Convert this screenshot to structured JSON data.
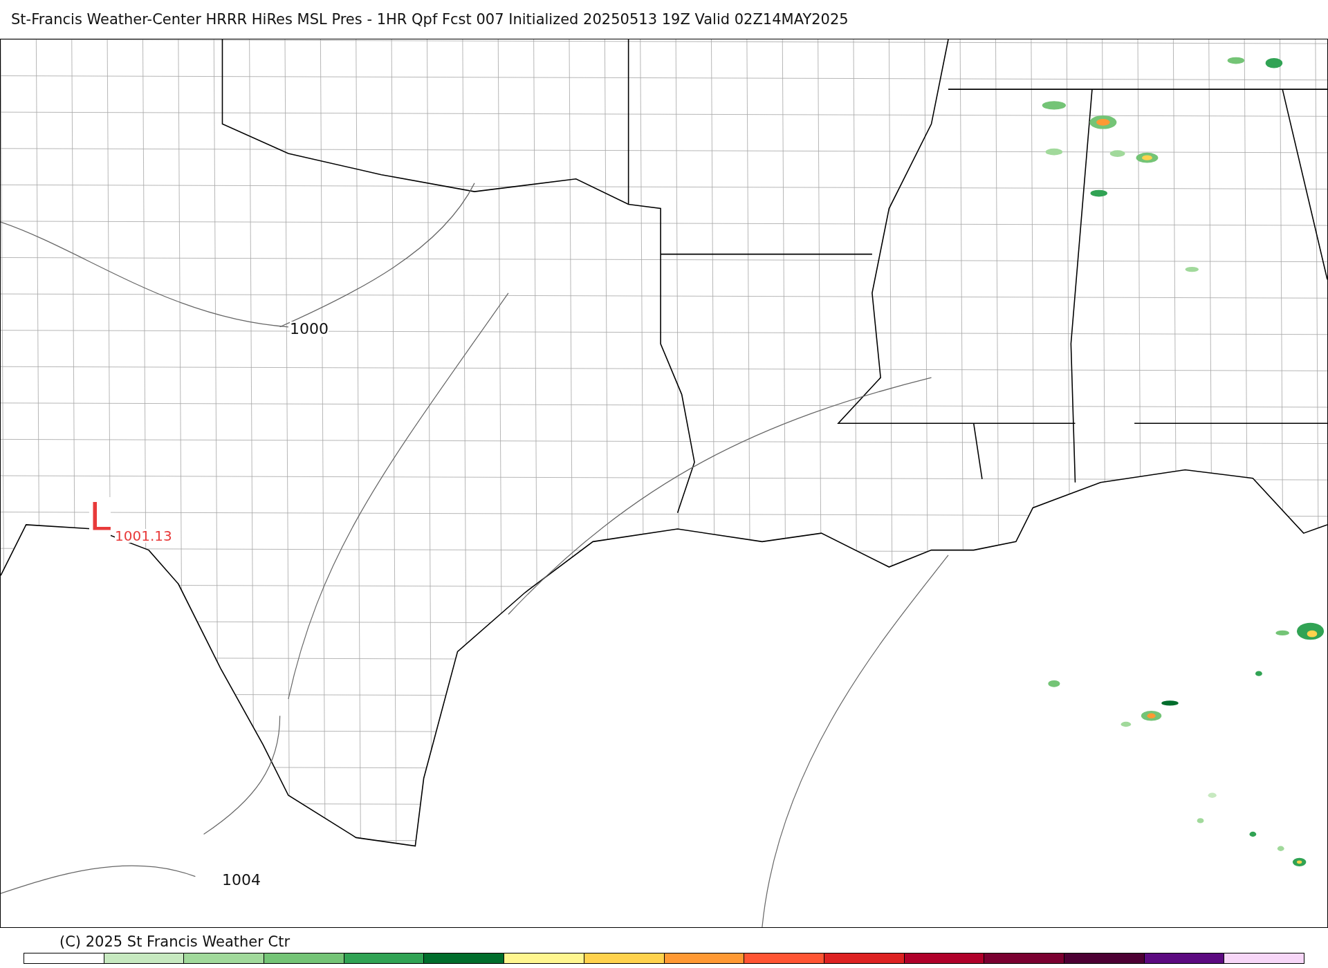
{
  "title": "St-Francis Weather-Center HRRR HiRes MSL Pres - 1HR Qpf Fcst 007 Initialized 20250513 19Z Valid 02Z14MAY2025",
  "map": {
    "labels": [
      {
        "kind": "isobar",
        "text": "1000"
      },
      {
        "kind": "isobar",
        "text": "1004"
      },
      {
        "kind": "low",
        "text": "L"
      },
      {
        "kind": "low_value",
        "text": "1001.13"
      }
    ]
  },
  "copyright": "(C) 2025 St Francis Weather Ctr",
  "colorbar": {
    "items": [
      {
        "color": "#ffffff"
      },
      {
        "color": "#c7e9c0"
      },
      {
        "color": "#a1d99b"
      },
      {
        "color": "#74c476"
      },
      {
        "color": "#31a354"
      },
      {
        "color": "#006d2c"
      },
      {
        "color": "#fff68f"
      },
      {
        "color": "#ffd24d"
      },
      {
        "color": "#ff9933"
      },
      {
        "color": "#ff5533"
      },
      {
        "color": "#dd2222"
      },
      {
        "color": "#b0002a"
      },
      {
        "color": "#7a0030"
      },
      {
        "color": "#4d0033"
      },
      {
        "color": "#5c0a80"
      },
      {
        "color": "#f7d6f7"
      }
    ]
  }
}
